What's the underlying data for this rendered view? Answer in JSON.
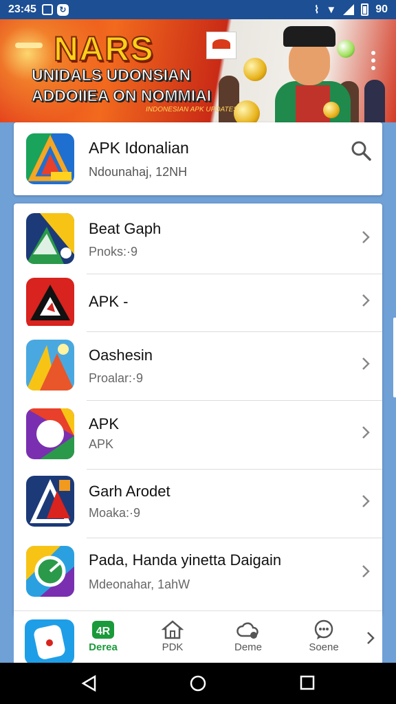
{
  "status_bar": {
    "time": "23:45",
    "battery_text": "90"
  },
  "banner": {
    "title": "NARS",
    "subtitle_line1": "UNIDALS UDONSIAN",
    "subtitle_line2": "ADDOIIEA ON NOMMIAI",
    "tagline": "INDONESIAN APK UPDATES"
  },
  "featured": {
    "title": "APK Idonalian",
    "subtitle": "Ndounahaj, 12NH",
    "icon": "apk-triangle-icon"
  },
  "apps": [
    {
      "title": "Beat Gaph",
      "subtitle": "Pnoks:·9",
      "icon": "beat-graph-icon"
    },
    {
      "title": "APK  -",
      "subtitle": "",
      "icon": "apk-red-icon"
    },
    {
      "title": "Oashesin",
      "subtitle": "Proalar:·9",
      "icon": "sunrise-app-icon"
    },
    {
      "title": "APK",
      "subtitle": "APK",
      "icon": "apk-circle-icon"
    },
    {
      "title": "Garh Arodet",
      "subtitle": "Moaka:·9",
      "icon": "garh-app-icon"
    },
    {
      "title": "Pada, Handa yinetta Daigain",
      "subtitle": "Mdeonahar, 1ahW",
      "icon": "gauge-app-icon"
    }
  ],
  "bottom_nav": {
    "tabs": [
      {
        "label": "Derea",
        "icon": "apk-logo-icon",
        "active": true
      },
      {
        "label": "PDK",
        "icon": "home-icon",
        "active": false
      },
      {
        "label": "Deme",
        "icon": "settings-cloud-icon",
        "active": false
      },
      {
        "label": "Soene",
        "icon": "chat-icon",
        "active": false
      }
    ]
  },
  "colors": {
    "status_bar": "#1c4f94",
    "background": "#6fa0d6",
    "active_tab": "#1a9a3a"
  }
}
